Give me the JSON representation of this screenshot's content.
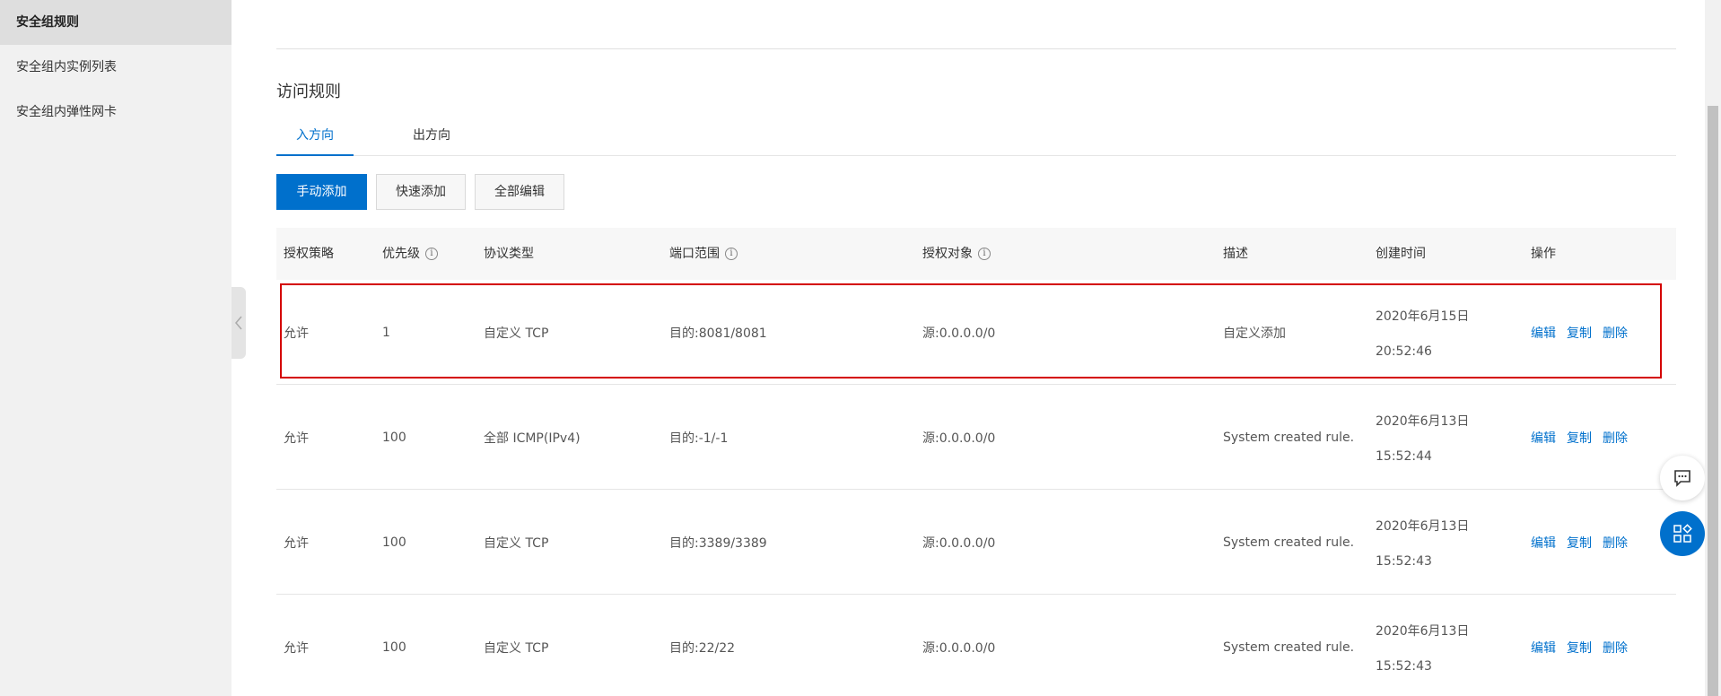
{
  "sidebar": {
    "items": [
      {
        "label": "安全组规则",
        "active": true
      },
      {
        "label": "安全组内实例列表",
        "active": false
      },
      {
        "label": "安全组内弹性网卡",
        "active": false
      }
    ]
  },
  "section": {
    "title": "访问规则"
  },
  "tabs": [
    {
      "label": "入方向",
      "active": true
    },
    {
      "label": "出方向",
      "active": false
    }
  ],
  "toolbar": {
    "manual_add": "手动添加",
    "quick_add": "快速添加",
    "edit_all": "全部编辑"
  },
  "table": {
    "headers": {
      "policy": "授权策略",
      "priority": "优先级",
      "protocol": "协议类型",
      "port_range": "端口范围",
      "auth_object": "授权对象",
      "description": "描述",
      "created": "创建时间",
      "actions": "操作"
    },
    "info_glyph": "i",
    "rows": [
      {
        "policy": "允许",
        "priority": "1",
        "protocol": "自定义 TCP",
        "port": "目的:8081/8081",
        "object": "源:0.0.0.0/0",
        "desc": "自定义添加",
        "date": "2020年6月15日",
        "time": "20:52:46",
        "highlighted": true
      },
      {
        "policy": "允许",
        "priority": "100",
        "protocol": "全部 ICMP(IPv4)",
        "port": "目的:-1/-1",
        "object": "源:0.0.0.0/0",
        "desc": "System created rule.",
        "date": "2020年6月13日",
        "time": "15:52:44",
        "highlighted": false
      },
      {
        "policy": "允许",
        "priority": "100",
        "protocol": "自定义 TCP",
        "port": "目的:3389/3389",
        "object": "源:0.0.0.0/0",
        "desc": "System created rule.",
        "date": "2020年6月13日",
        "time": "15:52:43",
        "highlighted": false
      },
      {
        "policy": "允许",
        "priority": "100",
        "protocol": "自定义 TCP",
        "port": "目的:22/22",
        "object": "源:0.0.0.0/0",
        "desc": "System created rule.",
        "date": "2020年6月13日",
        "time": "15:52:43",
        "highlighted": false
      }
    ],
    "actions": {
      "edit": "编辑",
      "copy": "复制",
      "delete": "删除"
    }
  },
  "colors": {
    "accent": "#0070cc",
    "highlight": "#d40000"
  },
  "icons": {
    "collapse": "chevron-left-icon",
    "chat": "chat-icon",
    "apps": "apps-icon",
    "info": "info-icon"
  }
}
